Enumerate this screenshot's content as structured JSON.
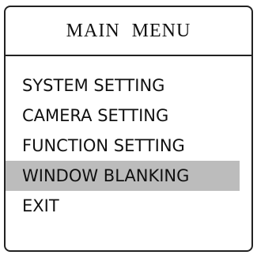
{
  "menu": {
    "title": "MAIN  MENU",
    "items": [
      {
        "label": "SYSTEM  SETTING",
        "selected": false
      },
      {
        "label": "CAMERA  SETTING",
        "selected": false
      },
      {
        "label": "FUNCTION  SETTING",
        "selected": false
      },
      {
        "label": "WINDOW  BLANKING",
        "selected": true
      },
      {
        "label": "EXIT",
        "selected": false
      }
    ]
  },
  "colors": {
    "border": "#222222",
    "selected_background": "#bcbcbc",
    "text": "#111111"
  }
}
